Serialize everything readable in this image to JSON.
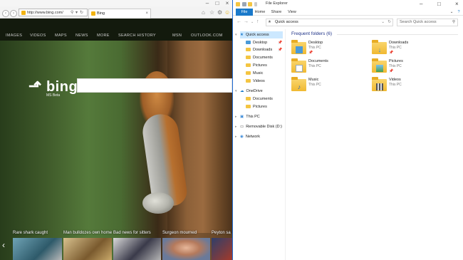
{
  "browser": {
    "url": "http://www.bing.com/",
    "tab_title": "Bing",
    "nav": [
      "IMAGES",
      "VIDEOS",
      "MAPS",
      "NEWS",
      "MORE",
      "SEARCH HISTORY",
      "MSN",
      "OUTLOOK.COM"
    ],
    "logo": "bing",
    "logo_sub": "MS Beta",
    "news": [
      {
        "headline": "Rare shark caught"
      },
      {
        "headline": "Man bulldozes own home"
      },
      {
        "headline": "Bad news for sitters"
      },
      {
        "headline": "Surgeon mourned"
      },
      {
        "headline": "Peyton sa"
      }
    ]
  },
  "explorer": {
    "window_title": "File Explorer",
    "ribbon_tabs": [
      "File",
      "Home",
      "Share",
      "View"
    ],
    "path": "Quick access",
    "search_placeholder": "Search Quick access",
    "nav_items": [
      {
        "label": "Quick access"
      },
      {
        "label": "Desktop"
      },
      {
        "label": "Downloads"
      },
      {
        "label": "Documents"
      },
      {
        "label": "Pictures"
      },
      {
        "label": "Music"
      },
      {
        "label": "Videos"
      },
      {
        "label": "OneDrive"
      },
      {
        "label": "Documents"
      },
      {
        "label": "Pictures"
      },
      {
        "label": "This PC"
      },
      {
        "label": "Removable Disk (D:)"
      },
      {
        "label": "Network"
      }
    ],
    "section_title": "Frequent folders (6)",
    "folders": [
      {
        "name": "Desktop",
        "location": "This PC"
      },
      {
        "name": "Downloads",
        "location": "This PC"
      },
      {
        "name": "Documents",
        "location": "This PC"
      },
      {
        "name": "Pictures",
        "location": "This PC"
      },
      {
        "name": "Music",
        "location": "This PC"
      },
      {
        "name": "Videos",
        "location": "This PC"
      }
    ],
    "colors": {
      "accent": "#1979ca",
      "selected": "#cce8ff",
      "heading": "#1e3287",
      "folder": "#f4c542"
    }
  }
}
